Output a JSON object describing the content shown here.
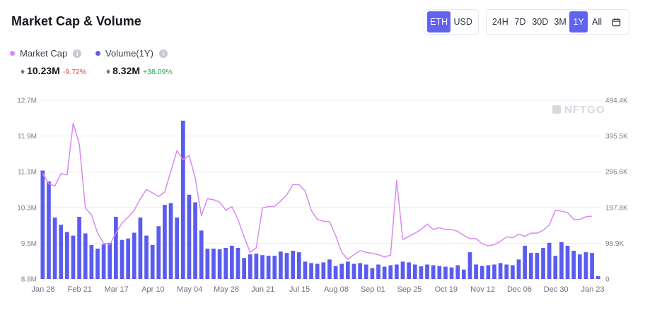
{
  "header": {
    "title": "Market Cap & Volume",
    "currency_options": [
      {
        "label": "ETH",
        "active": true
      },
      {
        "label": "USD",
        "active": false
      }
    ],
    "range_options": [
      {
        "label": "24H",
        "active": false
      },
      {
        "label": "7D",
        "active": false
      },
      {
        "label": "30D",
        "active": false
      },
      {
        "label": "3M",
        "active": false
      },
      {
        "label": "1Y",
        "active": true
      },
      {
        "label": "All",
        "active": false
      }
    ],
    "calendar_icon": "calendar-icon"
  },
  "legend": {
    "market_cap": {
      "label": "Market Cap",
      "value": "10.23M",
      "change": "-9.72%",
      "color": "#d98af0",
      "info_icon": "info-icon"
    },
    "volume": {
      "label": "Volume(1Y)",
      "value": "8.32M",
      "change": "+38.09%",
      "color": "#5a5cf0",
      "info_icon": "info-icon"
    },
    "currency_icon": "eth-icon"
  },
  "watermark": "NFTGO",
  "colors": {
    "accent": "#6163ee",
    "bar": "#5a5cf0",
    "line": "#d98af0",
    "negative": "#e04848",
    "positive": "#25a35a"
  },
  "chart_data": {
    "type": "bar+line",
    "x_ticks": [
      "Jan 28",
      "Feb 21",
      "Mar 17",
      "Apr 10",
      "May 04",
      "May 28",
      "Jun 21",
      "Jul 15",
      "Aug 08",
      "Sep 01",
      "Sep 25",
      "Oct 19",
      "Nov 12",
      "Dec 06",
      "Dec 30",
      "Jan 23"
    ],
    "y_left": {
      "ticks": [
        "12.7M",
        "11.9M",
        "11.1M",
        "10.3M",
        "9.5M",
        "8.8M"
      ],
      "ylim": [
        8.8,
        12.7
      ],
      "unit": "M"
    },
    "y_right": {
      "ticks": [
        "494.4K",
        "395.5K",
        "296.6K",
        "197.8K",
        "98.9K",
        "0"
      ],
      "ylim": [
        0,
        494.4
      ],
      "unit": "K"
    },
    "grid": true,
    "series": [
      {
        "name": "Market Cap",
        "kind": "line",
        "axis": "left",
        "values": [
          11.1,
          10.88,
          10.83,
          11.1,
          11.07,
          12.2,
          11.75,
          10.35,
          10.2,
          9.8,
          9.58,
          9.55,
          9.8,
          10.02,
          10.15,
          10.3,
          10.55,
          10.75,
          10.68,
          10.6,
          10.7,
          11.15,
          11.6,
          11.4,
          11.5,
          11.0,
          10.18,
          10.55,
          10.53,
          10.48,
          10.3,
          10.38,
          10.1,
          9.72,
          9.38,
          9.48,
          10.35,
          10.38,
          10.38,
          10.5,
          10.64,
          10.86,
          10.86,
          10.72,
          10.3,
          10.1,
          10.06,
          10.05,
          9.75,
          9.38,
          9.23,
          9.33,
          9.42,
          9.38,
          9.36,
          9.33,
          9.28,
          9.32,
          10.95,
          9.66,
          9.73,
          9.8,
          9.88,
          10.0,
          9.88,
          9.92,
          9.88,
          9.88,
          9.84,
          9.75,
          9.68,
          9.68,
          9.57,
          9.52,
          9.55,
          9.62,
          9.72,
          9.7,
          9.78,
          9.73,
          9.8,
          9.8,
          9.86,
          9.98,
          10.3,
          10.28,
          10.25,
          10.1,
          10.1,
          10.16,
          10.17
        ]
      },
      {
        "name": "Volume(1Y)",
        "kind": "bar",
        "axis": "right",
        "values": [
          300,
          270,
          170,
          150,
          130,
          120,
          172,
          126,
          94,
          84,
          96,
          100,
          172,
          108,
          112,
          128,
          170,
          120,
          94,
          146,
          205,
          210,
          170,
          438,
          233,
          212,
          134,
          84,
          84,
          82,
          86,
          92,
          86,
          58,
          68,
          70,
          66,
          64,
          64,
          76,
          72,
          78,
          74,
          48,
          44,
          42,
          46,
          54,
          36,
          42,
          48,
          42,
          44,
          40,
          30,
          40,
          34,
          38,
          40,
          48,
          46,
          40,
          35,
          40,
          38,
          36,
          34,
          32,
          38,
          26,
          74,
          40,
          36,
          38,
          40,
          44,
          40,
          38,
          54,
          92,
          72,
          72,
          86,
          100,
          64,
          102,
          92,
          78,
          68,
          74,
          72,
          8
        ]
      }
    ]
  }
}
